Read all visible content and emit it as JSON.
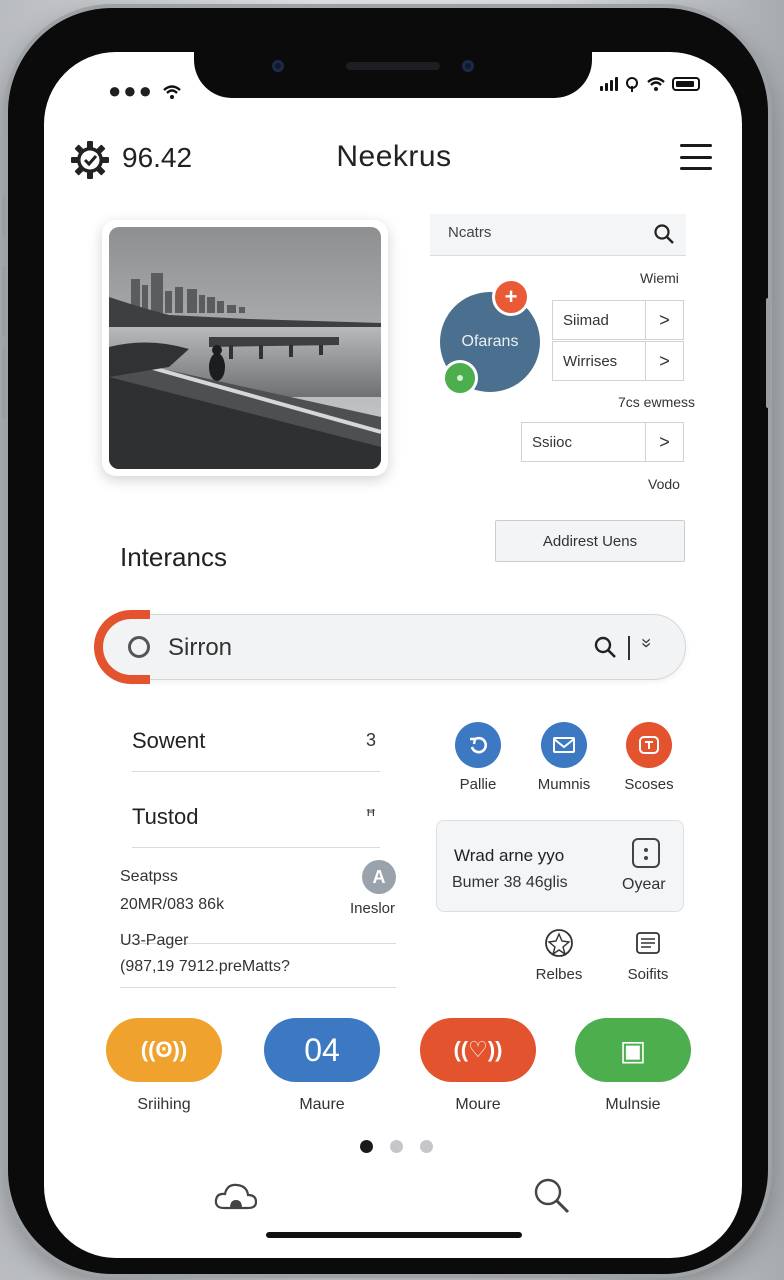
{
  "status_bar": {
    "left": "●●● ",
    "right_icons": [
      "signal-icon",
      "wifi-icon",
      "battery-icon"
    ]
  },
  "header": {
    "time": "96.42",
    "title": "Neekrus"
  },
  "panel": {
    "search_placeholder": "Ncatrs",
    "label_top": "Wiemi",
    "circle_label": "Ofarans",
    "circle_plus": "+",
    "rows": [
      {
        "label": "Siimad",
        "chevron": ">"
      },
      {
        "label": "Wirrises",
        "chevron": ">"
      }
    ],
    "label_mid": "7cs ewmess",
    "row3": {
      "label": "Ssiioc",
      "chevron": ">"
    },
    "label_bottom": "Vodo",
    "add_button": "Addirest Uens"
  },
  "section_title": "Interancs",
  "search": {
    "text": "Sirron",
    "chevrons": "»"
  },
  "list": [
    {
      "label": "Sowent",
      "count": "3"
    },
    {
      "label": "Tustod",
      "count": "ꟸ"
    }
  ],
  "stats": {
    "block1": {
      "line1": "Seatpss",
      "line2": "20MR/083 86k"
    },
    "block2": {
      "line1": "U3-Pager",
      "line2": "(987,19 7912.preMatts?"
    },
    "avatar_letter": "A",
    "avatar_label": "Ineslor"
  },
  "actions": [
    {
      "label": "Pallie",
      "color": "#3d79c2",
      "icon": "refresh-icon"
    },
    {
      "label": "Mumnis",
      "color": "#3d79c2",
      "icon": "mail-icon"
    },
    {
      "label": "Scoses",
      "color": "#e2532e",
      "icon": "tag-icon"
    }
  ],
  "info_card": {
    "title": "Wrad arne yyo",
    "sub": "Bumer 38 46glis",
    "icon_label": "Oyear"
  },
  "small_icons": [
    {
      "label": "Relbes",
      "icon": "badge-icon"
    },
    {
      "label": "Soifits",
      "icon": "document-icon"
    }
  ],
  "pills": [
    {
      "label": "Sriihing",
      "color": "#f0a22e",
      "glyph": "((ʘ))",
      "icon": "location-icon"
    },
    {
      "label": "Maure",
      "color": "#3d79c2",
      "glyph": "04",
      "icon": ""
    },
    {
      "label": "Moure",
      "color": "#e2532e",
      "glyph": "((♡))",
      "icon": "signal-heart-icon"
    },
    {
      "label": "Mulnsie",
      "color": "#4cae4c",
      "glyph": "▣",
      "icon": "card-icon"
    }
  ],
  "bottom_nav": [
    "home-cloud-icon",
    "search-icon"
  ]
}
